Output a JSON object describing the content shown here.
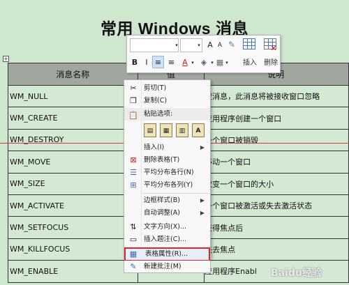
{
  "document": {
    "title": "常用 Windows 消息",
    "anchor_glyph": "+"
  },
  "table": {
    "headers": [
      "消息名称",
      "值",
      "说明"
    ],
    "rows": [
      {
        "name": "WM_NULL",
        "desc": "空消息，此消息将被接收窗口忽略"
      },
      {
        "name": "WM_CREATE",
        "desc": "应用程序创建一个窗口"
      },
      {
        "name": "WM_DESTROY",
        "desc": "一个窗口被销毁"
      },
      {
        "name": "WM_MOVE",
        "desc": "移动一个窗口"
      },
      {
        "name": "WM_SIZE",
        "desc": "改变一个窗口的大小"
      },
      {
        "name": "WM_ACTIVATE",
        "desc": "一个窗口被激活或失去激活状态"
      },
      {
        "name": "WM_SETFOCUS",
        "desc": "获得焦点后"
      },
      {
        "name": "WM_KILLFOCUS",
        "desc": "失去焦点"
      },
      {
        "name": "WM_ENABLE",
        "desc": "应用程序Enabl"
      }
    ]
  },
  "mini_toolbar": {
    "font_name_value": "",
    "font_size_value": "",
    "grow_font": "A",
    "shrink_font": "A",
    "bold": "B",
    "align_center": "≡",
    "align_justify": "≡",
    "font_color": "A",
    "insert_label": "插入",
    "delete_label": "删除"
  },
  "context_menu": {
    "cut": "剪切(T)",
    "copy": "复制(C)",
    "paste_options": "粘贴选项:",
    "insert": "插入(I)",
    "delete_table": "删除表格(T)",
    "distribute_rows": "平均分布各行(N)",
    "distribute_columns": "平均分布各列(Y)",
    "border_styles": "边框样式(B)",
    "autofit": "自动调整(A)",
    "text_direction": "文字方向(X)...",
    "insert_caption": "插入题注(C)...",
    "table_properties": "表格属性(R)...",
    "new_comment": "新建批注(M)"
  },
  "watermark": "Baidu经验"
}
